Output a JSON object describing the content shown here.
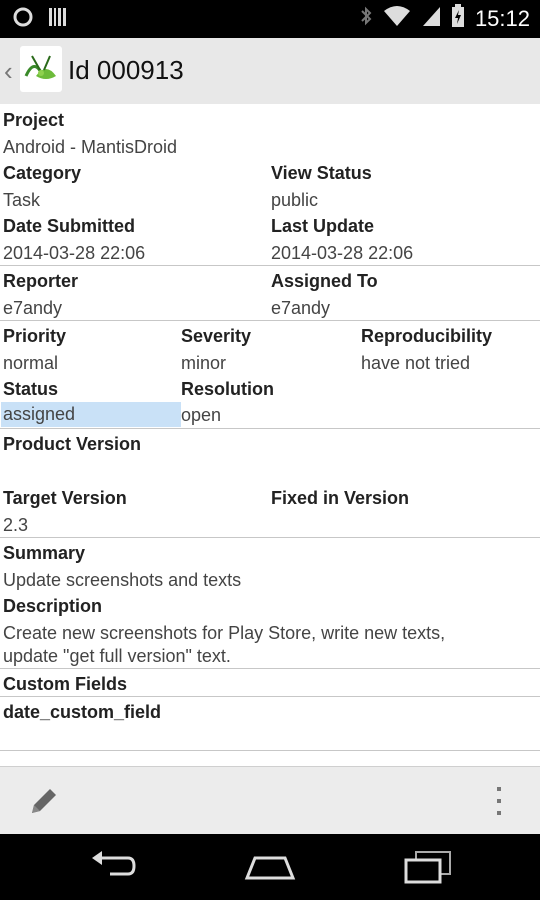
{
  "status_bar": {
    "time": "15:12"
  },
  "action_bar": {
    "title": "Id 000913",
    "logo": "mantis-logo"
  },
  "fields": {
    "project": {
      "label": "Project",
      "value": "Android - MantisDroid"
    },
    "category": {
      "label": "Category",
      "value": "Task"
    },
    "view_status": {
      "label": "View Status",
      "value": "public"
    },
    "date_submitted": {
      "label": "Date Submitted",
      "value": "2014-03-28 22:06"
    },
    "last_update": {
      "label": "Last Update",
      "value": "2014-03-28 22:06"
    },
    "reporter": {
      "label": "Reporter",
      "value": "e7andy"
    },
    "assigned_to": {
      "label": "Assigned To",
      "value": "e7andy"
    },
    "priority": {
      "label": "Priority",
      "value": "normal"
    },
    "severity": {
      "label": "Severity",
      "value": "minor"
    },
    "reproducibility": {
      "label": "Reproducibility",
      "value": "have not tried"
    },
    "status": {
      "label": "Status",
      "value": "assigned"
    },
    "resolution": {
      "label": "Resolution",
      "value": "open"
    },
    "product_version": {
      "label": "Product Version",
      "value": ""
    },
    "target_version": {
      "label": "Target Version",
      "value": "2.3"
    },
    "fixed_in_version": {
      "label": "Fixed in Version",
      "value": ""
    },
    "summary": {
      "label": "Summary",
      "value": "Update screenshots and texts"
    },
    "description": {
      "label": "Description",
      "line1": "Create new screenshots for Play Store, write new texts,",
      "line2": "update \"get full version\" text."
    },
    "custom_fields": {
      "label": "Custom Fields"
    },
    "date_custom_field": {
      "label": "date_custom_field"
    }
  },
  "toolbar": {
    "edit_icon": "pencil-icon",
    "more_icon": "overflow-menu-icon"
  },
  "nav": {
    "back_icon": "back-icon",
    "home_icon": "home-icon",
    "recents_icon": "recents-icon"
  },
  "colors": {
    "status_highlight": "#c9e1f7"
  }
}
